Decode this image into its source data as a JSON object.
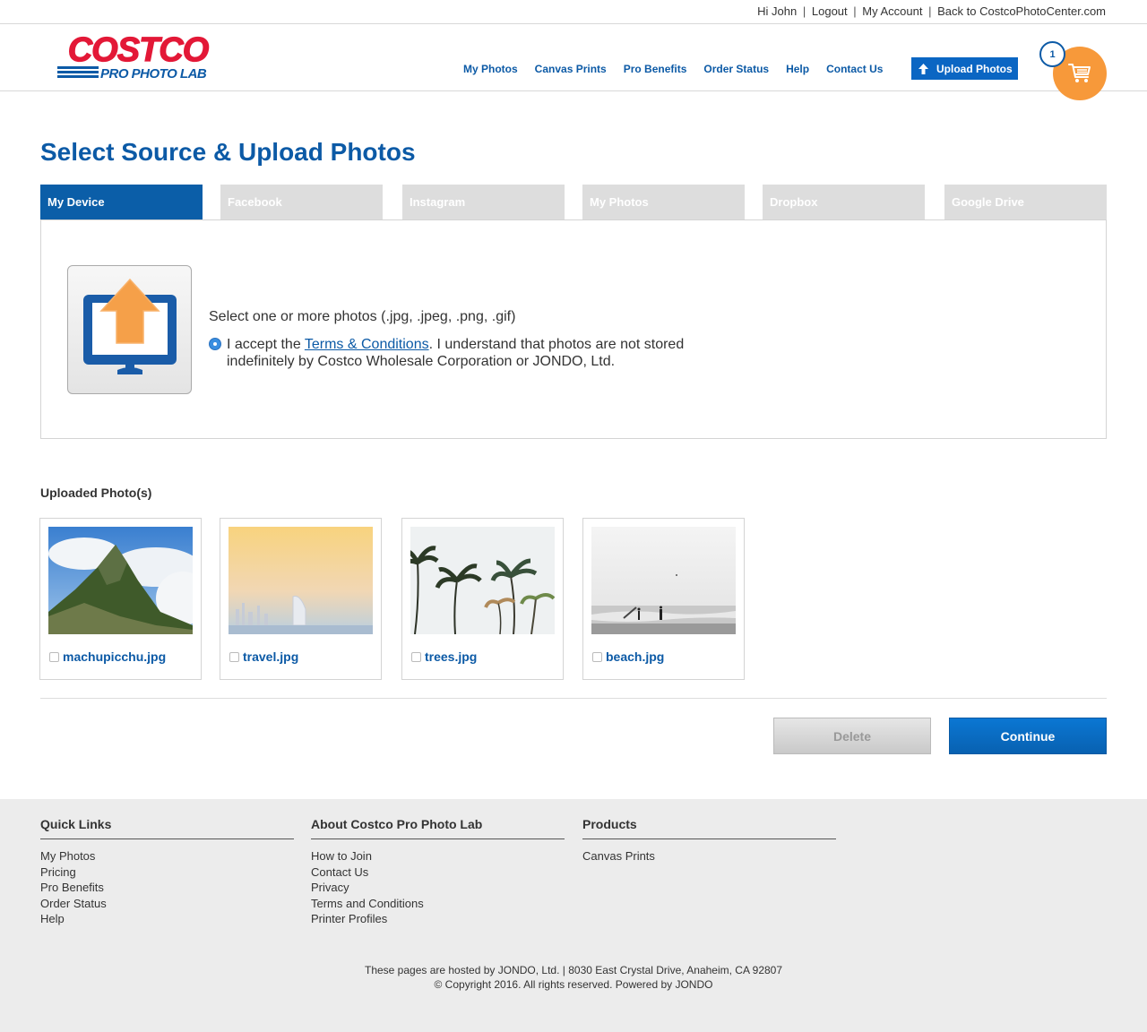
{
  "topbar": {
    "greeting": "Hi John",
    "logout": "Logout",
    "my_account": "My Account",
    "back_link": "Back to CostcoPhotoCenter.com",
    "separator": "|"
  },
  "header": {
    "logo_top": "COSTCO",
    "logo_bottom": "PRO PHOTO LAB",
    "nav": [
      "My Photos",
      "Canvas Prints",
      "Pro Benefits",
      "Order Status",
      "Help",
      "Contact Us"
    ],
    "upload_button": "Upload Photos",
    "cart_count": "1",
    "colors": {
      "brand_red": "#e31837",
      "brand_blue": "#0c5aa6",
      "cart_orange": "#f7993a"
    }
  },
  "page": {
    "title": "Select Source & Upload Photos"
  },
  "tabs": [
    "My Device",
    "Facebook",
    "Instagram",
    "My Photos",
    "Dropbox",
    "Google Drive"
  ],
  "source": {
    "select_text": "Select one or more photos (.jpg, .jpeg, .png, .gif)",
    "accept_prefix": "I accept the ",
    "terms_link": "Terms & Conditions",
    "accept_suffix": ". I understand that photos are not stored indefinitely by Costco Wholesale Corporation or JONDO, Ltd.",
    "icon": "monitor-upload-icon"
  },
  "uploaded": {
    "title": "Uploaded Photo(s)",
    "photos": [
      {
        "name": "machupicchu.jpg"
      },
      {
        "name": "travel.jpg"
      },
      {
        "name": "trees.jpg"
      },
      {
        "name": "beach.jpg"
      }
    ]
  },
  "actions": {
    "delete": "Delete",
    "continue": "Continue"
  },
  "footer": {
    "quick_links": {
      "title": "Quick Links",
      "items": [
        "My Photos",
        "Pricing",
        "Pro Benefits",
        "Order Status",
        "Help"
      ]
    },
    "about": {
      "title": "About Costco Pro Photo Lab",
      "items": [
        "How to Join",
        "Contact Us",
        "Privacy",
        "Terms and Conditions",
        "Printer Profiles"
      ]
    },
    "products": {
      "title": "Products",
      "items": [
        "Canvas Prints"
      ]
    },
    "hosted": "These pages are hosted by JONDO, Ltd. | 8030 East Crystal Drive, Anaheim, CA 92807",
    "copyright": "© Copyright 2016. All rights reserved. Powered by JONDO"
  }
}
